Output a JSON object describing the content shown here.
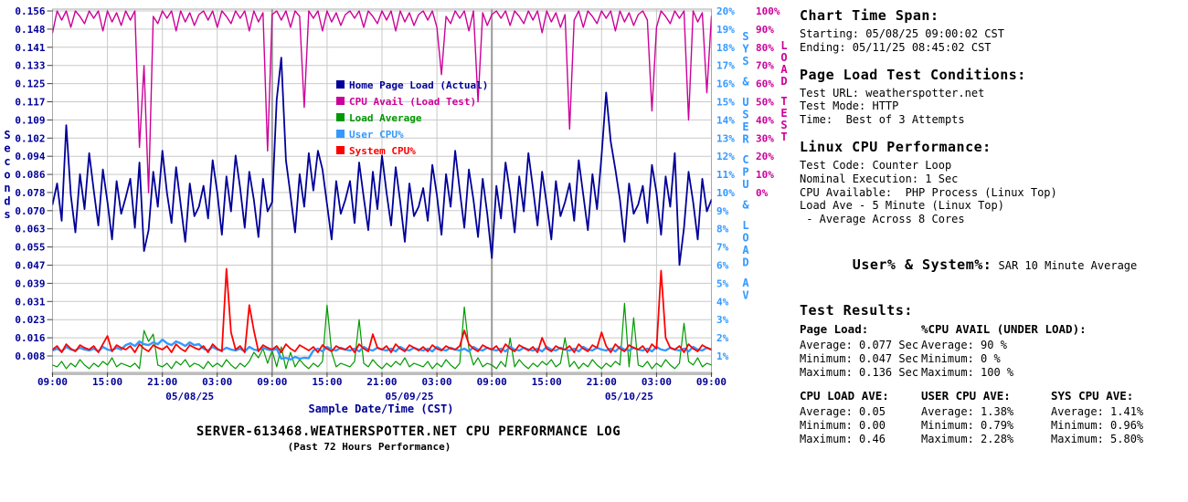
{
  "chart_data": {
    "type": "line",
    "title": "SERVER-613468.WEATHERSPOTTER.NET CPU PERFORMANCE LOG",
    "subtitle": "(Past 72 Hours Performance)",
    "x_start_hours": 0,
    "x_step_hours": 0.5,
    "x_axis": {
      "label": "Sample Date/Time (CST)",
      "color": "#000099",
      "tick_interval_hours": 6,
      "tick_labels": [
        "09:00",
        "15:00",
        "21:00",
        "03:00",
        "09:00",
        "15:00",
        "21:00",
        "03:00",
        "09:00",
        "15:00",
        "21:00",
        "03:00",
        "09:00"
      ],
      "date_labels": [
        {
          "text": "05/08/25",
          "hour": 15
        },
        {
          "text": "05/09/25",
          "hour": 39
        },
        {
          "text": "05/10/25",
          "hour": 63
        }
      ]
    },
    "axes": {
      "seconds": {
        "label": "Seconds",
        "color": "#000099",
        "min": 0.008,
        "max": 0.156,
        "tick_labels": [
          "0.156",
          "0.148",
          "0.141",
          "0.133",
          "0.125",
          "0.117",
          "0.109",
          "0.102",
          "0.094",
          "0.086",
          "0.078",
          "0.070",
          "0.063",
          "0.055",
          "0.047",
          "0.039",
          "0.031",
          "0.023",
          "0.016",
          "0.008"
        ]
      },
      "cpu_pct": {
        "label": "SYS & USER CPU & LOAD AV",
        "color": "#3399ff",
        "min": 1,
        "max": 20,
        "tick_labels": [
          "20%",
          "19%",
          "18%",
          "17%",
          "16%",
          "15%",
          "14%",
          "13%",
          "12%",
          "11%",
          "10%",
          "9%",
          "8%",
          "7%",
          "6%",
          "5%",
          "4%",
          "3%",
          "2%",
          "1%"
        ]
      },
      "load_test": {
        "label": "LOAD TEST",
        "color": "#cc0099",
        "min": 0,
        "max": 100,
        "tick_labels": [
          "100%",
          "90%",
          "80%",
          "70%",
          "60%",
          "50%",
          "40%",
          "30%",
          "20%",
          "10%",
          "0%"
        ]
      }
    },
    "legend_position": "inside-top-middle",
    "grid": true,
    "series": [
      {
        "key": "home-page-load",
        "name": "Home Page Load (Actual)",
        "color": "#000099",
        "axis": "seconds",
        "values": [
          0.073,
          0.082,
          0.066,
          0.107,
          0.077,
          0.061,
          0.086,
          0.071,
          0.095,
          0.079,
          0.064,
          0.088,
          0.074,
          0.058,
          0.083,
          0.069,
          0.076,
          0.084,
          0.063,
          0.091,
          0.053,
          0.062,
          0.087,
          0.072,
          0.096,
          0.078,
          0.065,
          0.089,
          0.073,
          0.057,
          0.082,
          0.068,
          0.072,
          0.081,
          0.067,
          0.092,
          0.078,
          0.06,
          0.085,
          0.07,
          0.094,
          0.08,
          0.063,
          0.087,
          0.075,
          0.059,
          0.084,
          0.07,
          0.074,
          0.118,
          0.136,
          0.092,
          0.077,
          0.061,
          0.086,
          0.072,
          0.095,
          0.079,
          0.096,
          0.088,
          0.073,
          0.058,
          0.083,
          0.069,
          0.075,
          0.083,
          0.065,
          0.091,
          0.076,
          0.062,
          0.087,
          0.071,
          0.094,
          0.078,
          0.064,
          0.089,
          0.074,
          0.057,
          0.082,
          0.068,
          0.072,
          0.08,
          0.066,
          0.09,
          0.077,
          0.06,
          0.086,
          0.072,
          0.096,
          0.079,
          0.063,
          0.088,
          0.075,
          0.059,
          0.084,
          0.069,
          0.05,
          0.081,
          0.067,
          0.091,
          0.078,
          0.061,
          0.085,
          0.07,
          0.095,
          0.08,
          0.064,
          0.087,
          0.073,
          0.058,
          0.083,
          0.068,
          0.074,
          0.082,
          0.066,
          0.092,
          0.077,
          0.062,
          0.086,
          0.071,
          0.094,
          0.121,
          0.1,
          0.088,
          0.075,
          0.057,
          0.082,
          0.069,
          0.073,
          0.081,
          0.065,
          0.09,
          0.078,
          0.06,
          0.085,
          0.072,
          0.095,
          0.047,
          0.063,
          0.087,
          0.074,
          0.058,
          0.084,
          0.07,
          0.075
        ]
      },
      {
        "key": "cpu-avail",
        "name": "CPU Avail (Load Test)",
        "color": "#cc0099",
        "axis": "load_test",
        "values": [
          88,
          100,
          95,
          100,
          91,
          100,
          97,
          93,
          100,
          96,
          100,
          89,
          100,
          94,
          99,
          92,
          100,
          95,
          100,
          25,
          70,
          0,
          97,
          93,
          100,
          96,
          100,
          89,
          100,
          94,
          99,
          92,
          98,
          100,
          95,
          100,
          91,
          100,
          97,
          93,
          100,
          96,
          100,
          89,
          100,
          94,
          99,
          23,
          98,
          100,
          95,
          100,
          91,
          100,
          97,
          47,
          100,
          96,
          100,
          89,
          100,
          94,
          99,
          92,
          98,
          100,
          96,
          100,
          91,
          100,
          97,
          93,
          100,
          95,
          100,
          89,
          100,
          94,
          99,
          92,
          98,
          100,
          95,
          100,
          91,
          65,
          97,
          93,
          100,
          96,
          100,
          89,
          100,
          50,
          99,
          92,
          98,
          100,
          96,
          100,
          92,
          100,
          97,
          93,
          100,
          95,
          100,
          88,
          100,
          94,
          99,
          91,
          98,
          35,
          95,
          100,
          91,
          100,
          97,
          93,
          100,
          96,
          100,
          89,
          100,
          94,
          99,
          92,
          98,
          100,
          95,
          45,
          91,
          100,
          97,
          93,
          100,
          96,
          100,
          40,
          100,
          94,
          99,
          55,
          97
        ]
      },
      {
        "key": "load-average",
        "name": "Load Average",
        "color": "#009900",
        "axis": "cpu_pct",
        "values": [
          0.5,
          0.4,
          0.7,
          0.3,
          0.6,
          0.4,
          0.8,
          0.5,
          0.3,
          0.6,
          0.4,
          0.7,
          0.5,
          0.9,
          0.4,
          0.6,
          0.5,
          0.4,
          0.6,
          0.3,
          2.4,
          1.8,
          2.2,
          0.5,
          0.4,
          0.6,
          0.3,
          0.7,
          0.5,
          0.8,
          0.4,
          0.6,
          0.5,
          0.3,
          0.7,
          0.4,
          0.6,
          0.4,
          0.8,
          0.5,
          0.3,
          0.6,
          0.4,
          0.7,
          1.2,
          0.9,
          1.4,
          0.6,
          1.3,
          0.4,
          1.5,
          0.3,
          1.2,
          0.4,
          0.8,
          0.5,
          0.3,
          0.6,
          0.4,
          0.7,
          3.8,
          1.2,
          0.4,
          0.6,
          0.5,
          0.4,
          0.7,
          3.0,
          0.6,
          0.4,
          0.8,
          0.5,
          0.3,
          0.6,
          0.4,
          0.7,
          0.5,
          0.9,
          0.4,
          0.6,
          0.5,
          0.4,
          0.7,
          0.3,
          0.6,
          0.4,
          0.8,
          0.5,
          0.3,
          0.6,
          3.7,
          1.4,
          0.5,
          0.9,
          0.4,
          0.6,
          0.5,
          0.3,
          0.7,
          0.4,
          2.0,
          0.4,
          0.8,
          0.5,
          0.3,
          0.6,
          0.4,
          0.7,
          0.5,
          0.8,
          0.4,
          0.6,
          2.0,
          0.4,
          0.7,
          0.3,
          0.6,
          0.4,
          0.8,
          0.5,
          0.3,
          0.6,
          0.4,
          0.7,
          0.5,
          3.9,
          0.4,
          3.1,
          0.5,
          0.4,
          0.7,
          0.3,
          0.6,
          0.4,
          0.8,
          0.5,
          0.3,
          0.6,
          2.8,
          0.7,
          0.5,
          0.9,
          0.4,
          0.6,
          0.5
        ]
      },
      {
        "key": "user-cpu",
        "name": "User CPU%",
        "color": "#3399ff",
        "axis": "cpu_pct",
        "values": [
          1.3,
          1.4,
          1.25,
          1.5,
          1.35,
          1.3,
          1.45,
          1.35,
          1.3,
          1.4,
          1.25,
          1.5,
          1.35,
          1.3,
          1.45,
          1.35,
          1.6,
          1.7,
          1.55,
          1.8,
          1.65,
          1.6,
          1.75,
          1.65,
          1.9,
          1.7,
          1.6,
          1.8,
          1.7,
          1.55,
          1.75,
          1.6,
          1.65,
          1.4,
          1.3,
          1.5,
          1.35,
          1.3,
          1.45,
          1.35,
          1.3,
          1.4,
          1.25,
          1.5,
          1.35,
          1.3,
          1.45,
          1.35,
          1.3,
          1.4,
          0.85,
          0.9,
          0.8,
          0.95,
          0.85,
          0.9,
          0.88,
          1.3,
          1.4,
          1.25,
          1.5,
          1.35,
          1.3,
          1.45,
          1.35,
          1.3,
          1.4,
          1.25,
          1.5,
          1.35,
          1.3,
          1.45,
          1.35,
          1.3,
          1.4,
          1.25,
          1.5,
          1.35,
          1.3,
          1.45,
          1.35,
          1.3,
          1.4,
          1.25,
          1.5,
          1.35,
          1.3,
          1.45,
          1.35,
          1.3,
          1.4,
          1.25,
          1.5,
          1.35,
          1.3,
          1.45,
          1.35,
          1.3,
          1.4,
          1.25,
          1.5,
          1.35,
          1.3,
          1.45,
          1.35,
          1.3,
          1.4,
          1.25,
          1.5,
          1.35,
          1.3,
          1.45,
          1.35,
          1.3,
          1.4,
          1.25,
          1.5,
          1.35,
          1.3,
          1.45,
          1.35,
          1.3,
          1.4,
          1.25,
          1.5,
          1.35,
          1.3,
          1.45,
          1.35,
          1.3,
          1.4,
          1.25,
          1.5,
          1.35,
          1.3,
          1.45,
          1.35,
          1.3,
          1.4,
          1.25,
          1.5,
          1.35,
          1.3,
          1.45,
          1.35
        ]
      },
      {
        "key": "system-cpu",
        "name": "System CPU%",
        "color": "#ff0000",
        "axis": "cpu_pct",
        "values": [
          1.35,
          1.55,
          1.2,
          1.65,
          1.4,
          1.25,
          1.6,
          1.45,
          1.35,
          1.55,
          1.2,
          1.65,
          2.1,
          1.25,
          1.6,
          1.45,
          1.35,
          1.55,
          1.2,
          1.65,
          1.4,
          1.25,
          1.6,
          1.45,
          1.35,
          1.55,
          1.2,
          1.65,
          1.4,
          1.25,
          1.6,
          1.45,
          1.35,
          1.55,
          1.2,
          1.65,
          1.4,
          1.25,
          5.8,
          2.3,
          1.35,
          1.55,
          1.2,
          3.8,
          2.4,
          1.25,
          1.6,
          1.45,
          1.35,
          1.55,
          1.2,
          1.65,
          1.4,
          1.25,
          1.6,
          1.45,
          1.3,
          1.5,
          1.2,
          1.6,
          1.4,
          1.25,
          1.55,
          1.4,
          1.35,
          1.55,
          1.2,
          1.65,
          1.4,
          1.25,
          2.2,
          1.45,
          1.35,
          1.55,
          1.2,
          1.65,
          1.4,
          1.25,
          1.6,
          1.45,
          1.3,
          1.5,
          1.25,
          1.6,
          1.4,
          1.3,
          1.55,
          1.4,
          1.35,
          1.55,
          2.4,
          1.65,
          1.4,
          1.25,
          1.6,
          1.45,
          1.35,
          1.55,
          1.2,
          1.65,
          1.4,
          1.25,
          1.6,
          1.45,
          1.3,
          1.5,
          1.2,
          2.0,
          1.4,
          1.25,
          1.55,
          1.4,
          1.35,
          1.55,
          1.2,
          1.65,
          1.4,
          1.25,
          1.6,
          1.45,
          2.3,
          1.55,
          1.2,
          1.65,
          1.4,
          1.25,
          1.6,
          1.45,
          1.35,
          1.55,
          1.2,
          1.65,
          1.4,
          5.7,
          2.0,
          1.45,
          1.35,
          1.55,
          1.2,
          1.65,
          1.4,
          1.25,
          1.6,
          1.45,
          1.35
        ]
      }
    ]
  },
  "info_panel": {
    "sections": [
      {
        "heading": "Chart Time Span:",
        "lines": [
          "Starting: 05/08/25 09:00:02 CST",
          "Ending: 05/11/25 08:45:02 CST"
        ]
      },
      {
        "heading": "Page Load Test Conditions:",
        "lines": [
          "Test URL: weatherspotter.net",
          "Test Mode: HTTP",
          "Time:  Best of 3 Attempts"
        ]
      },
      {
        "heading": "Linux CPU Performance:",
        "lines": [
          "Test Code: Counter Loop",
          "Nominal Execution: 1 Sec",
          "CPU Available:  PHP Process (Linux Top)",
          "Load Ave - 5 Minute (Linux Top)",
          " - Average Across 8 Cores"
        ]
      },
      {
        "heading": "User% & System%:",
        "inline": " SAR 10 Minute Average"
      }
    ],
    "results": {
      "heading": "Test Results:",
      "groups": [
        {
          "title": "Page Load:",
          "rows": [
            "Average: 0.077 Sec",
            "Minimum: 0.047 Sec",
            "Maximum: 0.136 Sec"
          ]
        },
        {
          "title": "%CPU AVAIL (UNDER LOAD):",
          "rows": [
            "Average: 90 %",
            "Minimum: 0 %",
            "Maximum: 100 %"
          ]
        },
        {
          "title": "CPU LOAD AVE:",
          "rows": [
            "Average: 0.05",
            "Minimum: 0.00",
            "Maximum: 0.46"
          ]
        },
        {
          "title": "USER CPU AVE:",
          "rows": [
            "Average: 1.38%",
            "Minimum: 0.79%",
            "Maximum: 2.28%"
          ]
        },
        {
          "title": "SYS CPU AVE:",
          "rows": [
            "Average: 1.41%",
            "Minimum: 0.96%",
            "Maximum: 5.80%"
          ]
        }
      ]
    }
  }
}
